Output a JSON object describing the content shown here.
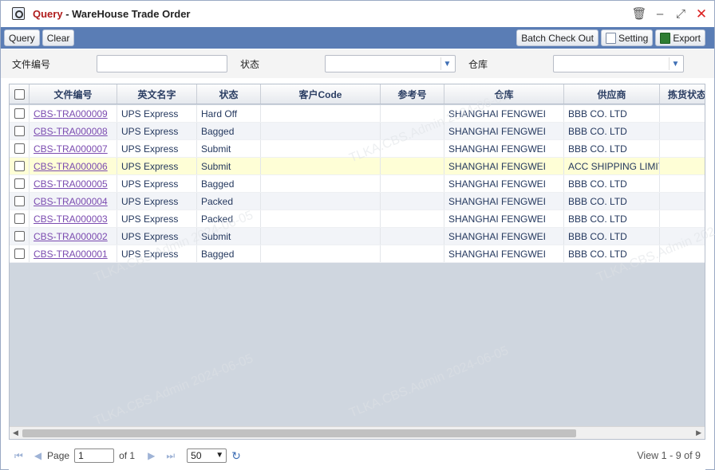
{
  "window": {
    "title_prefix": "Query",
    "title_sep": " - ",
    "title_main": "WareHouse Trade Order",
    "controls": [
      "trash-icon",
      "minimize-icon",
      "maximize-icon",
      "close-icon"
    ]
  },
  "toolbar": {
    "query_label": "Query",
    "clear_label": "Clear",
    "batch_label": "Batch Check Out",
    "setting_label": "Setting",
    "export_label": "Export"
  },
  "filter": {
    "doc_no_label": "文件编号",
    "doc_no_value": "",
    "status_label": "状态",
    "status_value": "",
    "warehouse_label": "仓库",
    "warehouse_value": ""
  },
  "grid": {
    "columns": [
      "文件编号",
      "英文名字",
      "状态",
      "客户Code",
      "参考号",
      "仓库",
      "供应商",
      "拣货状态"
    ],
    "rows": [
      {
        "doc": "CBS-TRA000009",
        "name": "UPS Express",
        "status": "Hard Off",
        "code": "",
        "ref": "",
        "wh": "SHANGHAI FENGWEI",
        "supplier": "BBB CO. LTD",
        "pick": ""
      },
      {
        "doc": "CBS-TRA000008",
        "name": "UPS Express",
        "status": "Bagged",
        "code": "",
        "ref": "",
        "wh": "SHANGHAI FENGWEI",
        "supplier": "BBB CO. LTD",
        "pick": ""
      },
      {
        "doc": "CBS-TRA000007",
        "name": "UPS Express",
        "status": "Submit",
        "code": "",
        "ref": "",
        "wh": "SHANGHAI FENGWEI",
        "supplier": "BBB CO. LTD",
        "pick": ""
      },
      {
        "doc": "CBS-TRA000006",
        "name": "UPS Express",
        "status": "Submit",
        "code": "",
        "ref": "",
        "wh": "SHANGHAI FENGWEI",
        "supplier": "ACC SHIPPING LIMITED",
        "pick": ""
      },
      {
        "doc": "CBS-TRA000005",
        "name": "UPS Express",
        "status": "Bagged",
        "code": "",
        "ref": "",
        "wh": "SHANGHAI FENGWEI",
        "supplier": "BBB CO. LTD",
        "pick": ""
      },
      {
        "doc": "CBS-TRA000004",
        "name": "UPS Express",
        "status": "Packed",
        "code": "",
        "ref": "",
        "wh": "SHANGHAI FENGWEI",
        "supplier": "BBB CO. LTD",
        "pick": ""
      },
      {
        "doc": "CBS-TRA000003",
        "name": "UPS Express",
        "status": "Packed",
        "code": "",
        "ref": "",
        "wh": "SHANGHAI FENGWEI",
        "supplier": "BBB CO. LTD",
        "pick": ""
      },
      {
        "doc": "CBS-TRA000002",
        "name": "UPS Express",
        "status": "Submit",
        "code": "",
        "ref": "",
        "wh": "SHANGHAI FENGWEI",
        "supplier": "BBB CO. LTD",
        "pick": ""
      },
      {
        "doc": "CBS-TRA000001",
        "name": "UPS Express",
        "status": "Bagged",
        "code": "",
        "ref": "",
        "wh": "SHANGHAI FENGWEI",
        "supplier": "BBB CO. LTD",
        "pick": ""
      }
    ]
  },
  "pager": {
    "page_label": "Page",
    "page_value": "1",
    "of_label": "of 1",
    "page_size": "50",
    "view_text": "View 1 - 9 of 9"
  },
  "watermark": "TLKA.CBS.Admin 2024-06-05"
}
